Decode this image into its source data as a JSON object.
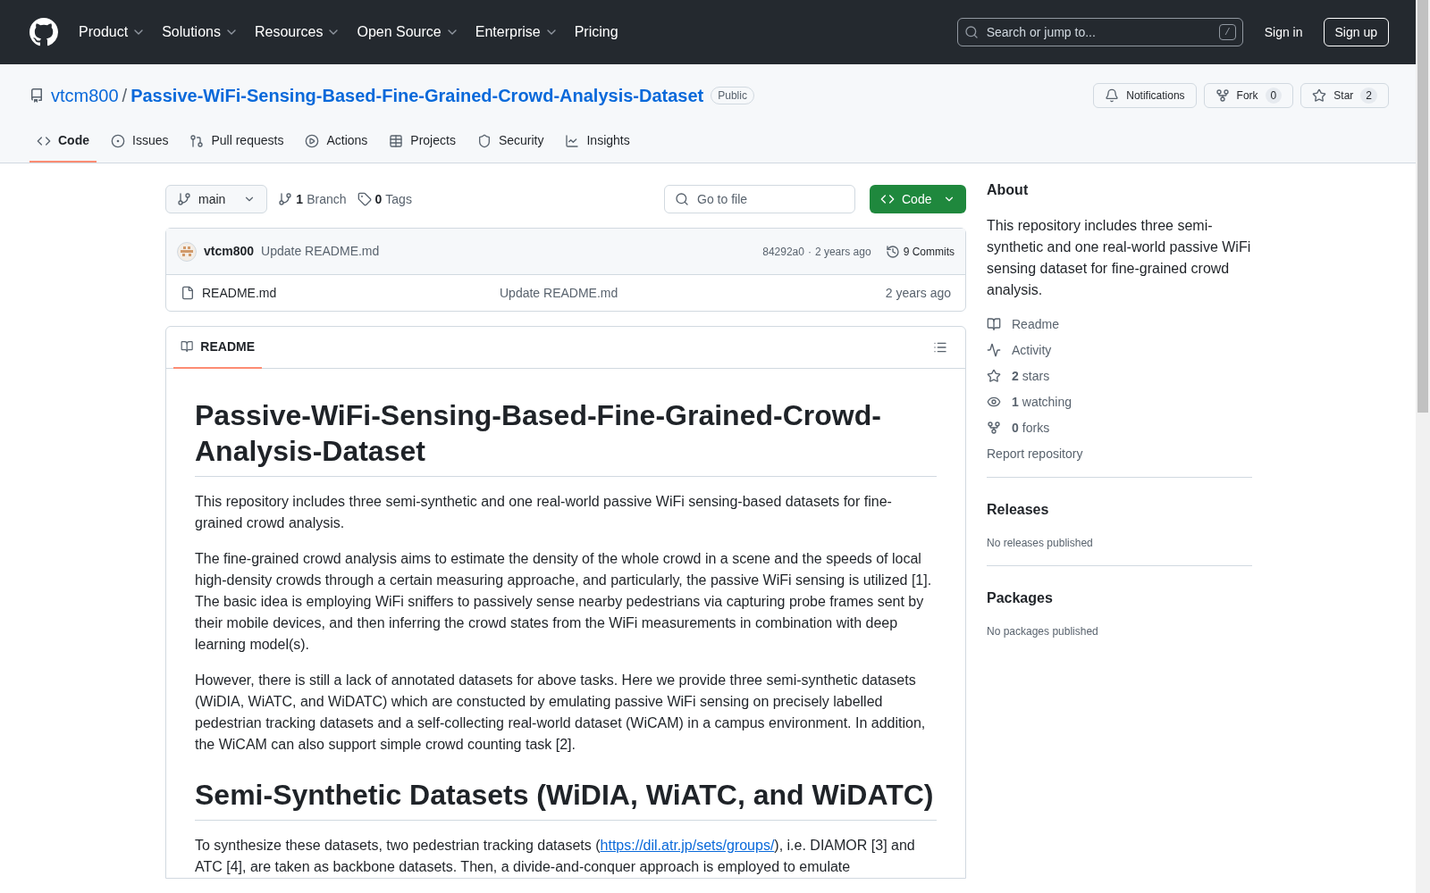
{
  "header": {
    "nav": [
      {
        "label": "Product",
        "has_menu": true
      },
      {
        "label": "Solutions",
        "has_menu": true
      },
      {
        "label": "Resources",
        "has_menu": true
      },
      {
        "label": "Open Source",
        "has_menu": true
      },
      {
        "label": "Enterprise",
        "has_menu": true
      },
      {
        "label": "Pricing",
        "has_menu": false
      }
    ],
    "search": {
      "placeholder": "Search or jump to...",
      "shortcut": "/"
    },
    "sign_in": "Sign in",
    "sign_up": "Sign up"
  },
  "repo": {
    "owner": "vtcm800",
    "separator": "/",
    "name": "Passive-WiFi-Sensing-Based-Fine-Grained-Crowd-Analysis-Dataset",
    "visibility": "Public",
    "notifications": "Notifications",
    "fork": {
      "label": "Fork",
      "count": "0"
    },
    "star": {
      "label": "Star",
      "count": "2"
    }
  },
  "tabs": [
    {
      "label": "Code",
      "selected": true
    },
    {
      "label": "Issues",
      "selected": false
    },
    {
      "label": "Pull requests",
      "selected": false
    },
    {
      "label": "Actions",
      "selected": false
    },
    {
      "label": "Projects",
      "selected": false
    },
    {
      "label": "Security",
      "selected": false
    },
    {
      "label": "Insights",
      "selected": false
    }
  ],
  "toolbar": {
    "branch": "main",
    "branches": {
      "count": "1",
      "label": "Branch"
    },
    "tags": {
      "count": "0",
      "label": "Tags"
    },
    "go_to_file": {
      "placeholder": "Go to file"
    },
    "code_button": "Code"
  },
  "commit": {
    "author": "vtcm800",
    "message": "Update README.md",
    "hash": "84292a0",
    "dot": "·",
    "time": "2 years ago",
    "commits": "9 Commits"
  },
  "files": [
    {
      "name": "README.md",
      "message": "Update README.md",
      "time": "2 years ago"
    }
  ],
  "readme": {
    "tab": "README",
    "title": "Passive-WiFi-Sensing-Based-Fine-Grained-Crowd-Analysis-Dataset",
    "blocks": [
      {
        "kind": "p",
        "text": "This repository includes three semi-synthetic and one real-world passive WiFi sensing-based datasets for fine-grained crowd analysis."
      },
      {
        "kind": "p",
        "text": "The fine-grained crowd analysis aims to estimate the density of the whole crowd in a scene and the speeds of local high-density crowds through a certain measuring approache, and particularly, the passive WiFi sensing is utilized [1]. The basic idea is employing WiFi sniffers to passively sense nearby pedestrians via capturing probe frames sent by their mobile devices, and then inferring the crowd states from the WiFi measurements in combination with deep learning model(s)."
      },
      {
        "kind": "p",
        "text": "However, there is still a lack of annotated datasets for above tasks. Here we provide three semi-synthetic datasets (WiDIA, WiATC, and WiDATC) which are constucted by emulating passive WiFi sensing on precisely labelled pedestrian tracking datasets and a self-collecting real-world dataset (WiCAM) in a campus environment. In addition, the WiCAM can also support simple crowd counting task [2]."
      },
      {
        "kind": "h2",
        "text": "Semi-Synthetic Datasets (WiDIA, WiATC, and WiDATC)"
      },
      {
        "kind": "p_link",
        "before": "To synthesize these datasets, two pedestrian tracking datasets (",
        "link": "https://dil.atr.jp/sets/groups/",
        "after": "), i.e. DIAMOR [3] and ATC [4], are taken as backbone datasets. Then, a divide-and-conquer approach is employed to emulate"
      }
    ]
  },
  "about": {
    "title": "About",
    "description": "This repository includes three semi-synthetic and one real-world passive WiFi sensing dataset for fine-grained crowd analysis.",
    "links": [
      {
        "label": "Readme"
      },
      {
        "label": "Activity"
      },
      {
        "count": "2",
        "label": "stars"
      },
      {
        "count": "1",
        "label": "watching"
      },
      {
        "count": "0",
        "label": "forks"
      }
    ],
    "report": "Report repository"
  },
  "releases": {
    "title": "Releases",
    "empty": "No releases published"
  },
  "packages": {
    "title": "Packages",
    "empty": "No packages published"
  }
}
